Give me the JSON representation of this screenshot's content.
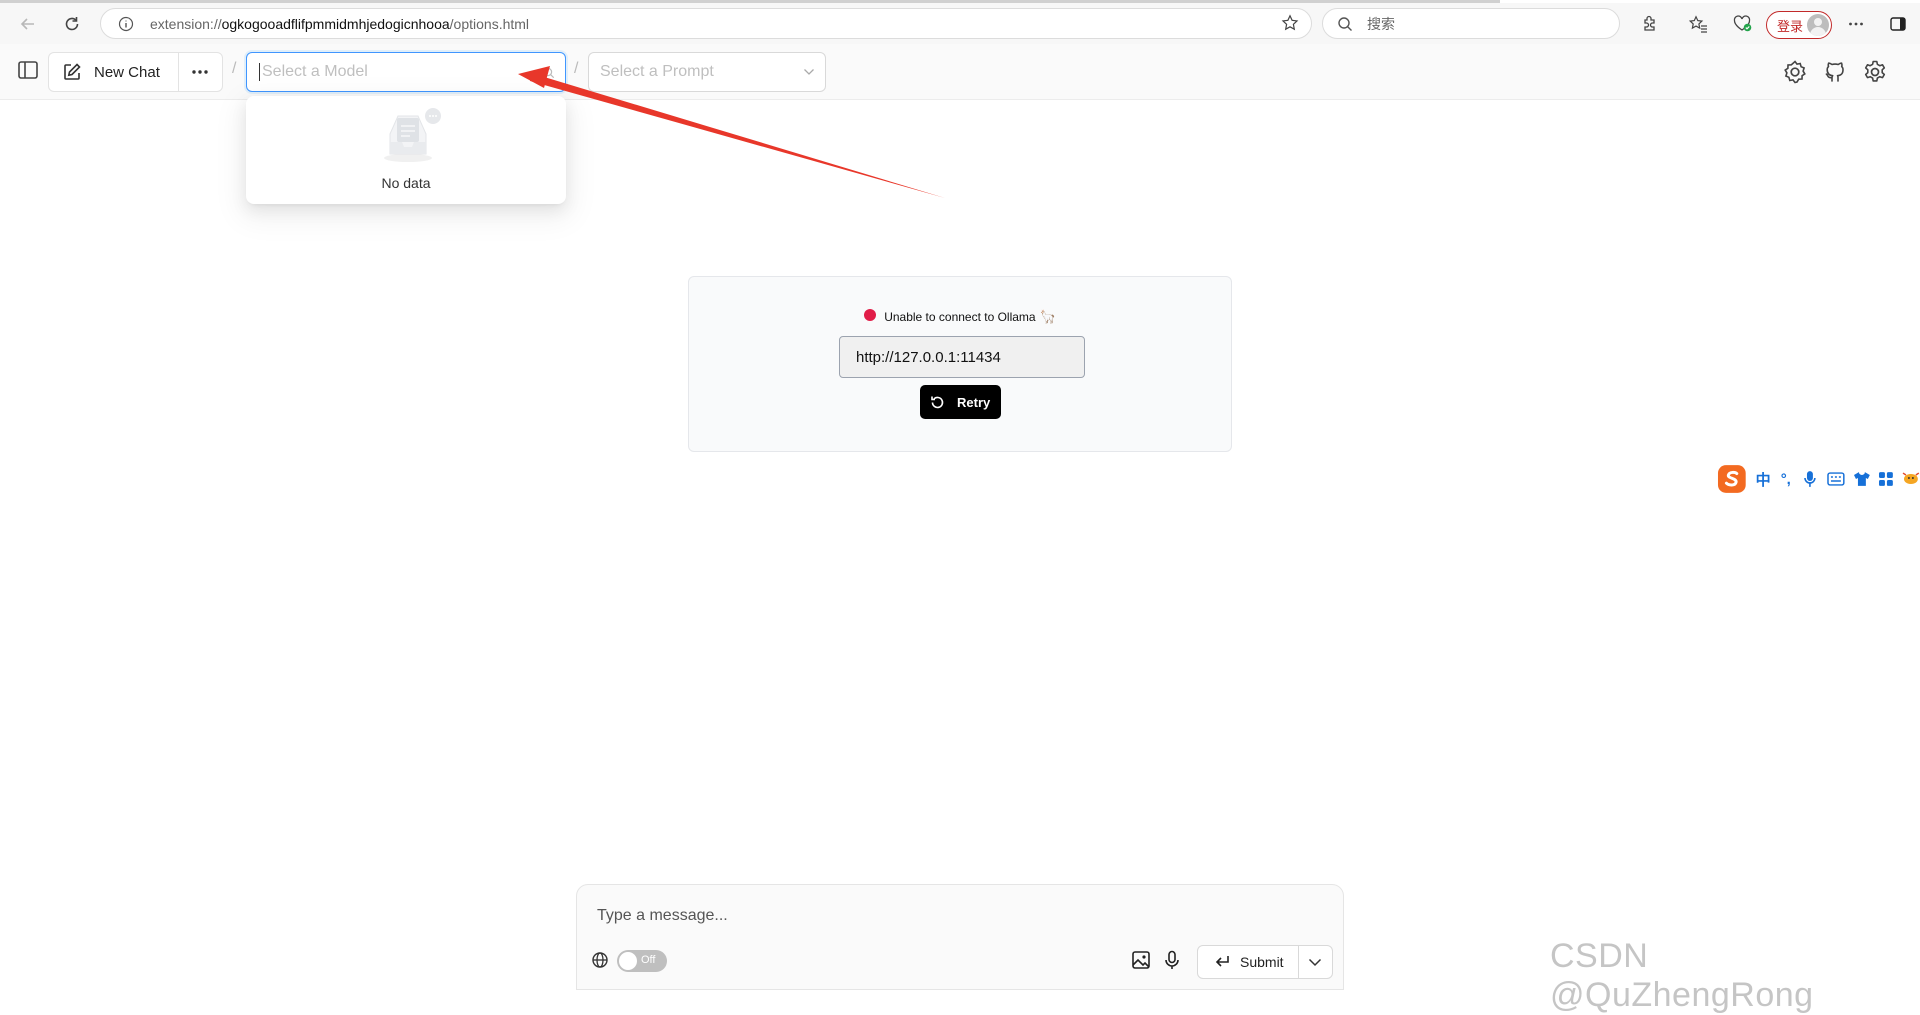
{
  "browser": {
    "url_prefix": "extension://",
    "url_host": "ogkogooadflifpmmidmhjedogicnhooa",
    "url_path": "/options.html",
    "search_placeholder": "搜索",
    "login_label": "登录"
  },
  "header": {
    "new_chat_label": "New Chat",
    "separator": "/",
    "model_placeholder": "Select a Model",
    "prompt_placeholder": "Select a Prompt"
  },
  "model_dropdown": {
    "empty_text": "No data"
  },
  "connection": {
    "status_text": "Unable to connect to Ollama",
    "status_emoji": "🦙",
    "status_color": "#e11d48",
    "url_value": "http://127.0.0.1:11434",
    "retry_label": "Retry"
  },
  "ime": {
    "items": [
      "中",
      "°,"
    ]
  },
  "composer": {
    "placeholder": "Type a message...",
    "toggle_label": "Off",
    "submit_label": "Submit"
  },
  "watermark": "CSDN @QuZhengRong",
  "colors": {
    "focus_border": "#4096ff",
    "annotation_arrow": "#e8372a"
  }
}
